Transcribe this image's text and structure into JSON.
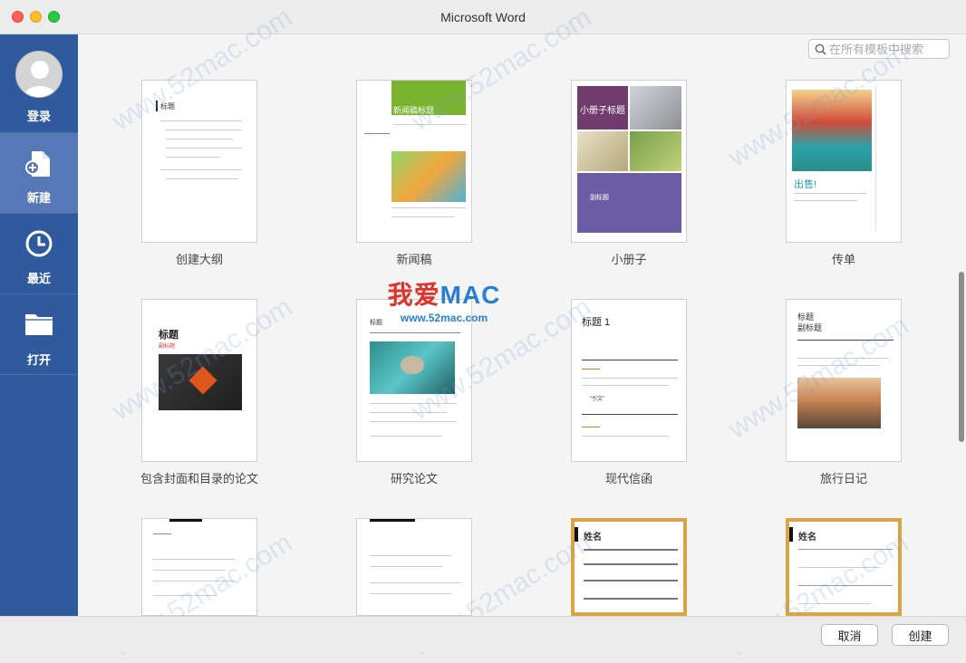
{
  "window": {
    "title": "Microsoft Word"
  },
  "sidebar": {
    "items": [
      {
        "label": "登录",
        "icon": "avatar-icon"
      },
      {
        "label": "新建",
        "icon": "new-document-icon",
        "active": true
      },
      {
        "label": "最近",
        "icon": "clock-icon"
      },
      {
        "label": "打开",
        "icon": "folder-icon"
      }
    ]
  },
  "search": {
    "placeholder": "在所有模板中搜索"
  },
  "templates": [
    {
      "label": "创建大纲",
      "preview": {
        "heading": "标题"
      }
    },
    {
      "label": "新闻稿",
      "preview": {
        "heading": "新闻稿标题"
      }
    },
    {
      "label": "小册子",
      "preview": {
        "heading": "小册子标题",
        "subheading": "副标题"
      }
    },
    {
      "label": "传单",
      "preview": {
        "heading": "出售!"
      }
    },
    {
      "label": "包含封面和目录的论文",
      "preview": {
        "heading": "标题",
        "subheading": "副标题"
      }
    },
    {
      "label": "研究论文",
      "preview": {
        "heading": "标题"
      }
    },
    {
      "label": "现代信函",
      "preview": {
        "heading": "标题 1",
        "quote": "\"引文\""
      }
    },
    {
      "label": "旅行日记",
      "preview": {
        "heading": "标题",
        "subheading": "副标题"
      }
    },
    {
      "label": "",
      "preview": {}
    },
    {
      "label": "",
      "preview": {}
    },
    {
      "label": "",
      "preview": {
        "heading": "姓名"
      }
    },
    {
      "label": "",
      "preview": {
        "heading": "姓名"
      }
    }
  ],
  "watermark": {
    "logo_text": "我爱MAC",
    "logo_url": "www.52mac.com",
    "repeat_text": "www.52mac.com"
  },
  "footer": {
    "cancel_label": "取消",
    "create_label": "创建"
  },
  "colors": {
    "sidebar": "#2f5a9e",
    "sidebar_active": "#5678b6",
    "newsletter_green": "#7ab32e",
    "brochure_purple": "#6f5a9a",
    "letter_orange": "#e07a22",
    "resume_gold": "#d9a441",
    "logo_red": "#e0312d",
    "logo_blue": "#2a7fd4"
  }
}
